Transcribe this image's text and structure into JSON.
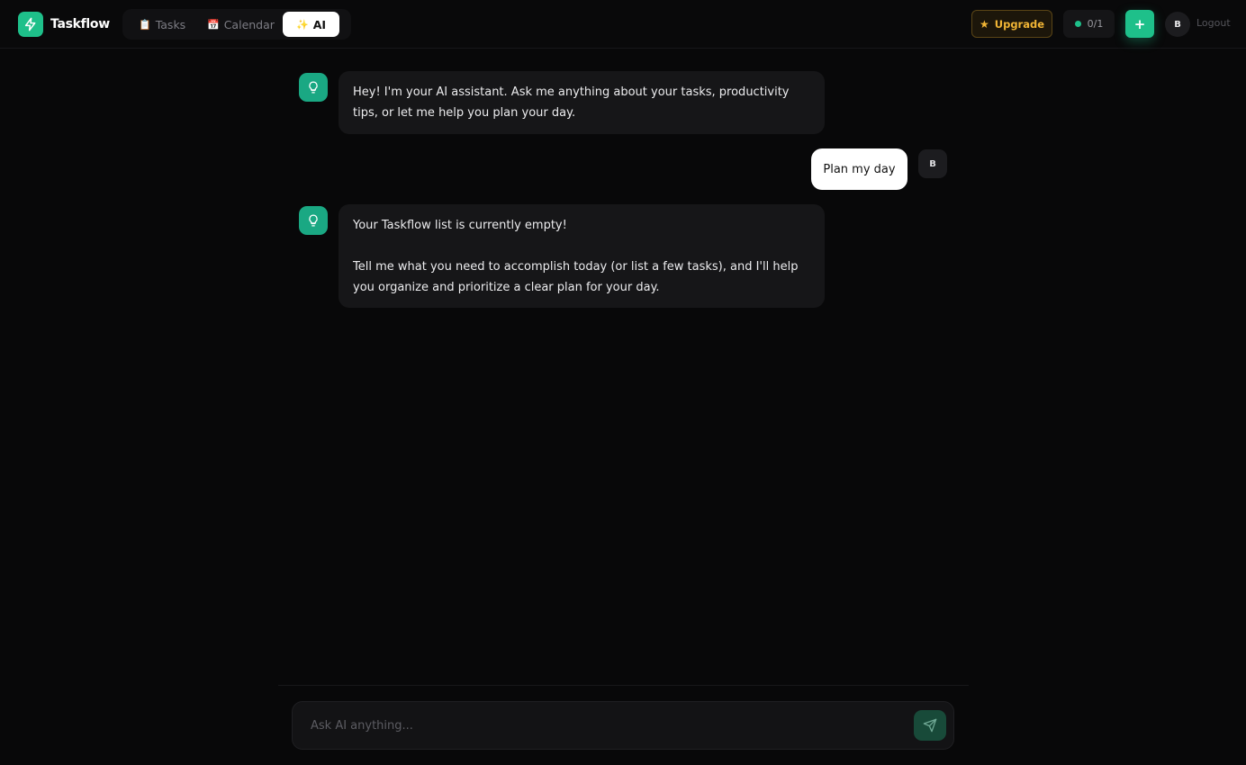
{
  "app": {
    "name": "Taskflow"
  },
  "nav": {
    "tabs": [
      {
        "label": "Tasks",
        "icon": "clipboard-icon",
        "glyph": "📋"
      },
      {
        "label": "Calendar",
        "icon": "calendar-icon",
        "glyph": "📅"
      },
      {
        "label": "AI",
        "icon": "sparkles-icon",
        "glyph": "✨"
      }
    ],
    "active": "AI"
  },
  "header": {
    "upgrade_label": "Upgrade",
    "upgrade_icon": "star-icon",
    "counter": "0/1",
    "add_label": "+",
    "user_initial": "B",
    "logout_label": "Logout"
  },
  "chat": {
    "messages": [
      {
        "role": "assistant",
        "icon": "lightbulb-icon",
        "paragraphs": [
          "Hey! I'm your AI assistant. Ask me anything about your tasks, productivity tips, or let me help you plan your day."
        ]
      },
      {
        "role": "user",
        "avatar": "B",
        "text": "Plan my day"
      },
      {
        "role": "assistant",
        "icon": "lightbulb-icon",
        "paragraphs": [
          "Your Taskflow list is currently empty!",
          "Tell me what you need to accomplish today (or list a few tasks), and I'll help you organize and prioritize a clear plan for your day."
        ]
      }
    ]
  },
  "composer": {
    "placeholder": "Ask AI anything...",
    "value": "",
    "send_icon": "send-icon"
  },
  "colors": {
    "background": "#080809",
    "accent": "#1ec08a",
    "upgrade": "#f1b535",
    "bubble": "#161618"
  }
}
